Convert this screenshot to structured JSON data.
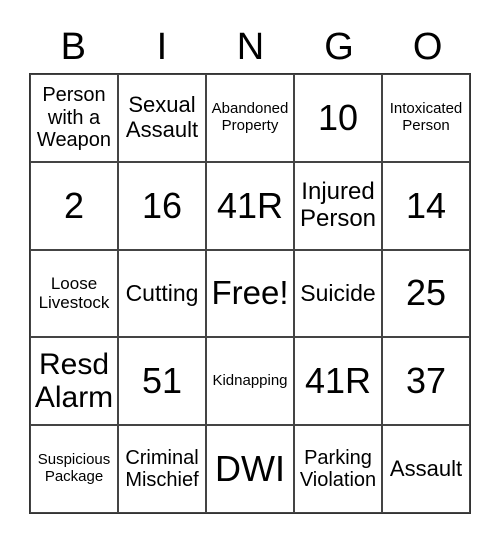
{
  "header": [
    "B",
    "I",
    "N",
    "G",
    "O"
  ],
  "cells": [
    "Person with a Weapon",
    "Sexual Assault",
    "Abandoned Property",
    "10",
    "Intoxicated Person",
    "2",
    "16",
    "41R",
    "Injured Person",
    "14",
    "Loose Livestock",
    "Cutting",
    "Free!",
    "Suicide",
    "25",
    "Resd Alarm",
    "51",
    "Kidnapping",
    "41R",
    "37",
    "Suspicious Package",
    "Criminal Mischief",
    "DWI",
    "Parking Violation",
    "Assault"
  ]
}
